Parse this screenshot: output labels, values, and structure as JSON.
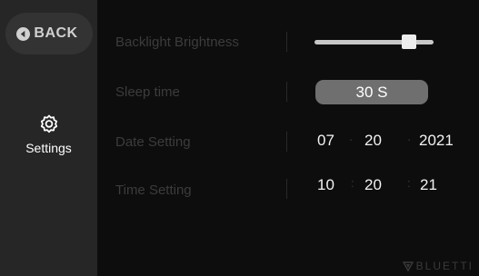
{
  "sidebar": {
    "back_label": "BACK",
    "settings_label": "Settings"
  },
  "settings": {
    "backlight": {
      "label": "Backlight Brightness",
      "level": 0.82
    },
    "sleep": {
      "label": "Sleep time",
      "value": "30 S"
    },
    "date": {
      "label": "Date Setting",
      "month": "07",
      "day": "20",
      "year": "2021"
    },
    "time": {
      "label": "Time Setting",
      "hour": "10",
      "minute": "20",
      "second": "21"
    }
  },
  "brand": {
    "name": "BLUETTI"
  },
  "icons": [
    "back-arrow-icon",
    "gear-icon",
    "bluetti-logo-icon"
  ],
  "colors": {
    "accent_text": "#f2f2f2",
    "dim_label": "#3c3c3c",
    "pill": "#6f6f6f"
  }
}
